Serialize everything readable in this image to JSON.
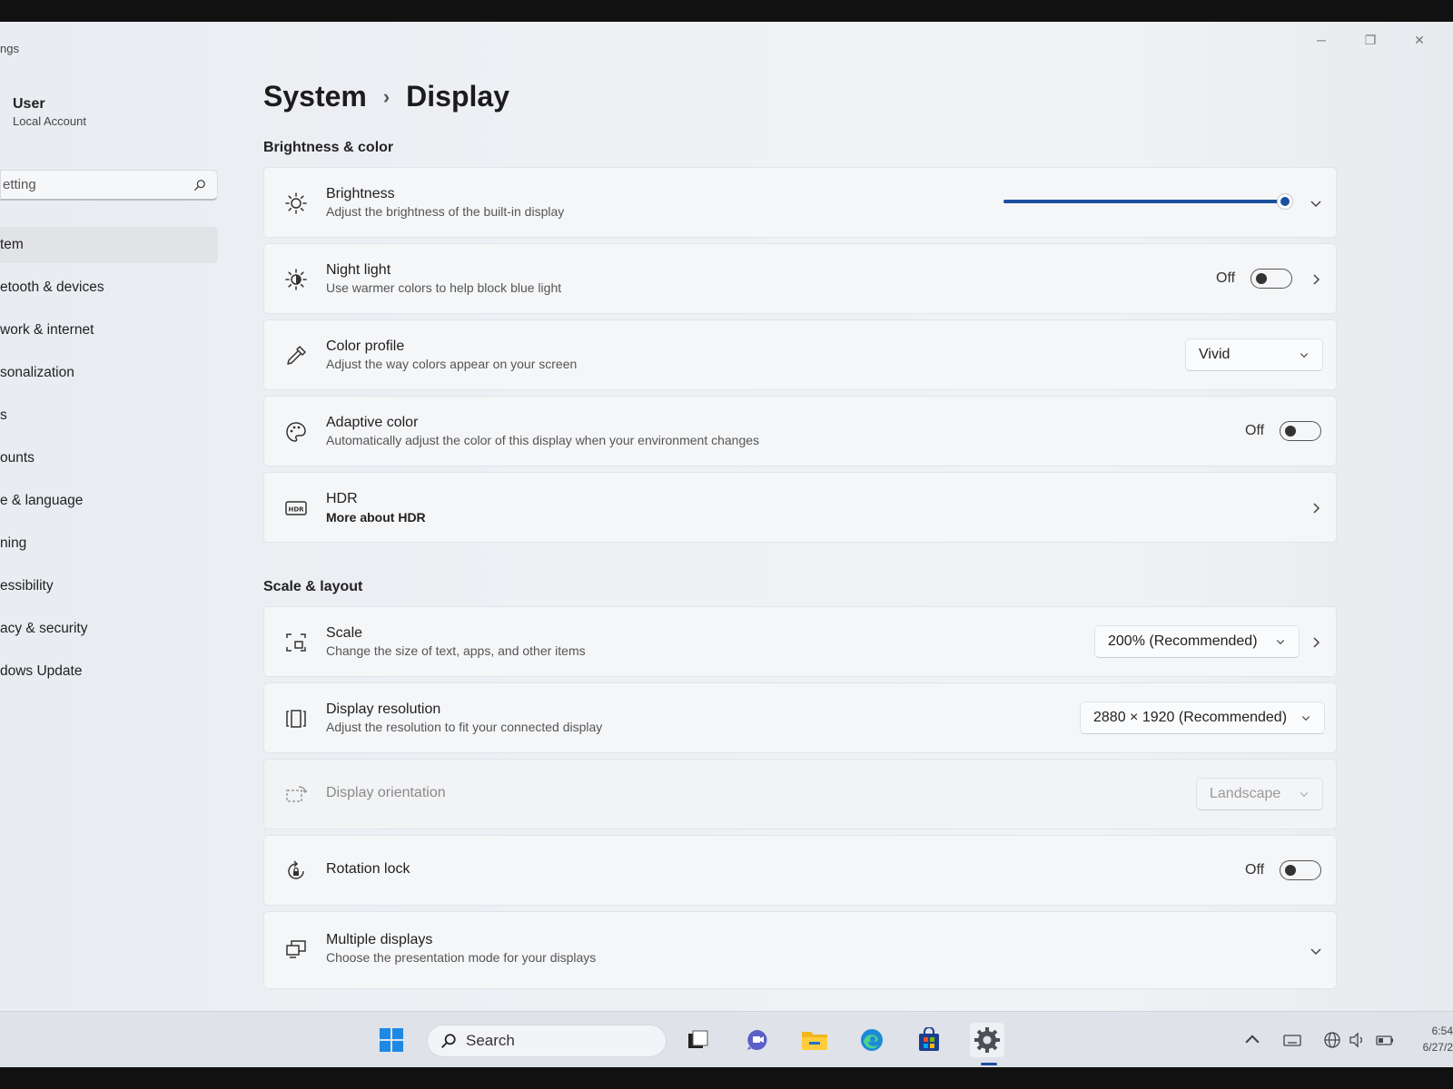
{
  "window": {
    "title_fragment": "ngs",
    "minimize": "─",
    "restore": "❐",
    "close": "✕"
  },
  "user": {
    "name": "User",
    "account_type": "Local Account"
  },
  "search": {
    "placeholder": "etting"
  },
  "nav": {
    "items": [
      {
        "label": "tem",
        "active": true
      },
      {
        "label": "etooth & devices"
      },
      {
        "label": "work & internet"
      },
      {
        "label": "sonalization"
      },
      {
        "label": "s"
      },
      {
        "label": "ounts"
      },
      {
        "label": "e & language"
      },
      {
        "label": "ning"
      },
      {
        "label": "essibility"
      },
      {
        "label": "acy & security"
      },
      {
        "label": "dows Update"
      }
    ]
  },
  "breadcrumb": {
    "parent": "System",
    "separator": "›",
    "current": "Display"
  },
  "sections": {
    "brightness_color": "Brightness & color",
    "scale_layout": "Scale & layout"
  },
  "rows": {
    "brightness": {
      "title": "Brightness",
      "subtitle": "Adjust the brightness of the built-in display",
      "level_percent": 100
    },
    "night_light": {
      "title": "Night light",
      "subtitle": "Use warmer colors to help block blue light",
      "state": "Off"
    },
    "color_profile": {
      "title": "Color profile",
      "subtitle": "Adjust the way colors appear on your screen",
      "value": "Vivid"
    },
    "adaptive_color": {
      "title": "Adaptive color",
      "subtitle": "Automatically adjust the color of this display when your environment changes",
      "state": "Off"
    },
    "hdr": {
      "title": "HDR",
      "link": "More about HDR"
    },
    "scale": {
      "title": "Scale",
      "subtitle": "Change the size of text, apps, and other items",
      "value": "200% (Recommended)"
    },
    "resolution": {
      "title": "Display resolution",
      "subtitle": "Adjust the resolution to fit your connected display",
      "value": "2880 × 1920 (Recommended)"
    },
    "orientation": {
      "title": "Display orientation",
      "value": "Landscape"
    },
    "rotation_lock": {
      "title": "Rotation lock",
      "state": "Off"
    },
    "multiple_displays": {
      "title": "Multiple displays",
      "subtitle": "Choose the presentation mode for your displays"
    }
  },
  "taskbar": {
    "search_label": "Search",
    "clock_time": "6:54",
    "clock_date": "6/27/2"
  },
  "colors": {
    "accent": "#1b4fa0",
    "background": "#eef0f4",
    "card": "#f5f6f8"
  }
}
